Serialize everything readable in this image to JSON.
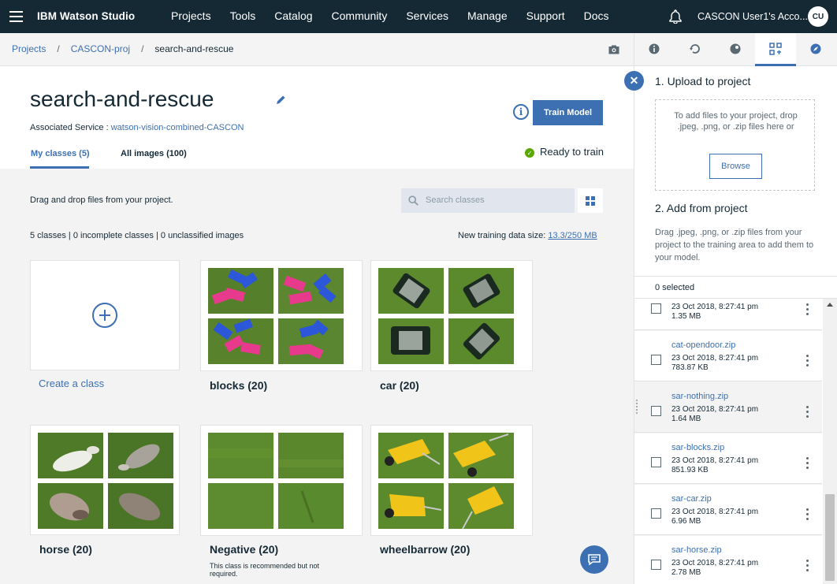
{
  "topbar": {
    "brand": "IBM Watson Studio",
    "nav": [
      "Projects",
      "Tools",
      "Catalog",
      "Community",
      "Services",
      "Manage",
      "Support",
      "Docs"
    ],
    "user": "CASCON User1's Acco...",
    "avatar": "CU"
  },
  "breadcrumb": {
    "items": [
      "Projects",
      "CASCON-proj",
      "search-and-rescue"
    ],
    "separator": "/"
  },
  "header": {
    "title": "search-and-rescue",
    "assoc_label": "Associated Service : ",
    "assoc_link": "watson-vision-combined-CASCON",
    "info_glyph": "i",
    "train_button": "Train Model",
    "status": "Ready to train",
    "status_glyph": "✓",
    "tabs": [
      "My classes (5)",
      "All images (100)"
    ]
  },
  "toolbar": {
    "drag_text": "Drag and drop files from your project.",
    "search_placeholder": "Search classes",
    "stats": "5 classes | 0 incomplete classes | 0 unclassified images",
    "size_label": "New training data size: ",
    "size_value": "13.3/250 MB"
  },
  "classes": {
    "create_label": "Create a class",
    "items": [
      {
        "label": "blocks (20)"
      },
      {
        "label": "car (20)"
      },
      {
        "label": "horse (20)"
      },
      {
        "label": "Negative (20)",
        "note": "This class is recommended but not required."
      },
      {
        "label": "wheelbarrow (20)"
      }
    ]
  },
  "panel": {
    "close_glyph": "✕",
    "upload_title": "1. Upload to project",
    "drop_text": "To add files to your project, drop .jpeg, .png, or .zip files here or",
    "browse": "Browse",
    "add_title": "2. Add from project",
    "add_desc": "Drag .jpeg, .png, or .zip files from your project to the training area to add them to your model.",
    "selected": "0 selected",
    "files": [
      {
        "name": "",
        "date": "23 Oct 2018, 8:27:41 pm",
        "size": "1.35 MB"
      },
      {
        "name": "cat-opendoor.zip",
        "date": "23 Oct 2018, 8:27:41 pm",
        "size": "783.87 KB"
      },
      {
        "name": "sar-nothing.zip",
        "date": "23 Oct 2018, 8:27:41 pm",
        "size": "1.64 MB"
      },
      {
        "name": "sar-blocks.zip",
        "date": "23 Oct 2018, 8:27:41 pm",
        "size": "851.93 KB"
      },
      {
        "name": "sar-car.zip",
        "date": "23 Oct 2018, 8:27:41 pm",
        "size": "6.96 MB"
      },
      {
        "name": "sar-horse.zip",
        "date": "23 Oct 2018, 8:27:41 pm",
        "size": "2.78 MB"
      }
    ]
  },
  "colors": {
    "brand_dark": "#152935",
    "accent": "#3d70b2",
    "ready": "#5aa700",
    "grass": "#5e8a2e"
  }
}
